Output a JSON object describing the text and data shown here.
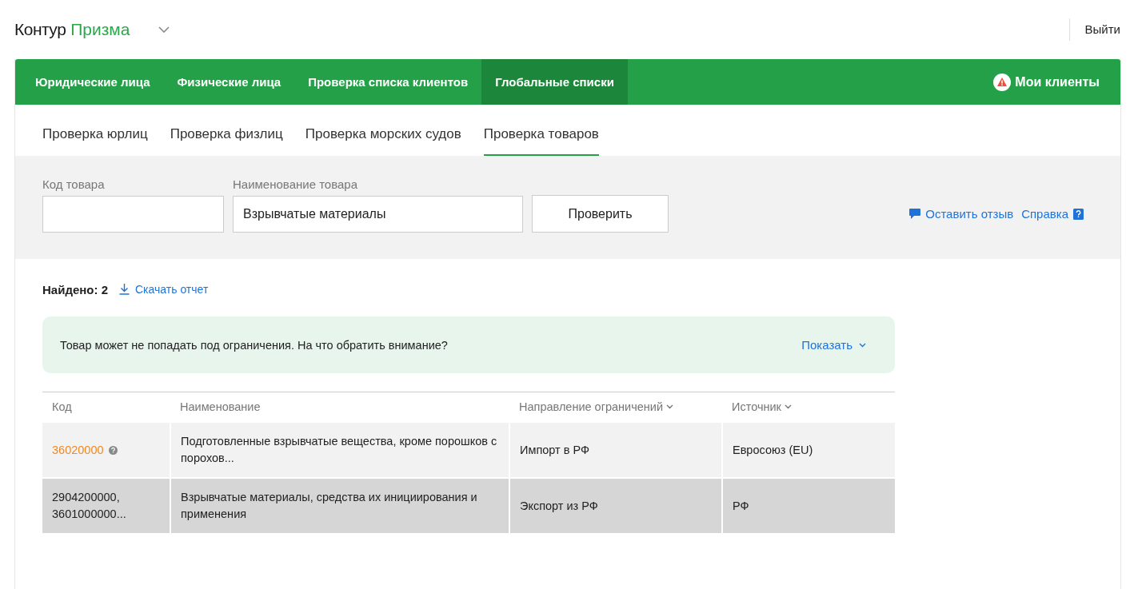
{
  "header": {
    "logo_main": "Контур",
    "logo_product": "Призма",
    "logout": "Выйти"
  },
  "main_nav": {
    "items": [
      {
        "label": "Юридические лица",
        "selected": false
      },
      {
        "label": "Физические лица",
        "selected": false
      },
      {
        "label": "Проверка списка клиентов",
        "selected": false
      },
      {
        "label": "Глобальные списки",
        "selected": true
      }
    ],
    "my_clients": "Мои клиенты"
  },
  "sub_tabs": [
    {
      "label": "Проверка юрлиц",
      "selected": false
    },
    {
      "label": "Проверка физлиц",
      "selected": false
    },
    {
      "label": "Проверка морских судов",
      "selected": false
    },
    {
      "label": "Проверка товаров",
      "selected": true
    }
  ],
  "search": {
    "code_label": "Код товара",
    "name_label": "Наименование товара",
    "name_value": "Взрывчатые материалы",
    "submit": "Проверить",
    "feedback": "Оставить отзыв",
    "help": "Справка"
  },
  "results": {
    "found": "Найдено: 2",
    "download": "Скачать отчет"
  },
  "notice": {
    "text": "Товар может не попадать под ограничения. На что обратить внимание?",
    "toggle": "Показать"
  },
  "table": {
    "columns": [
      {
        "label": "Код",
        "sortable": false
      },
      {
        "label": "Наименование",
        "sortable": false
      },
      {
        "label": "Направление ограничений",
        "sortable": true
      },
      {
        "label": "Источник",
        "sortable": true
      }
    ],
    "rows": [
      {
        "selected": false,
        "flagged": true,
        "cells": [
          "36020000",
          "Подготовленные взрывчатые вещества, кроме порошков с порохов...",
          "Импорт в РФ",
          "Евросоюз (EU)"
        ]
      },
      {
        "selected": true,
        "flagged": false,
        "cells": [
          "2904200000, 3601000000...",
          "Взрывчатые материалы, средства их инициирования и применения",
          "Экспорт из РФ",
          "РФ"
        ]
      }
    ]
  }
}
